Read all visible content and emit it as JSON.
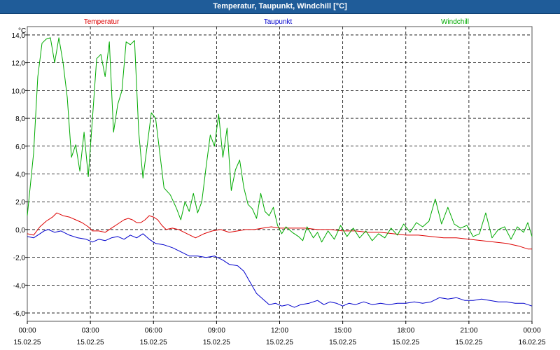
{
  "window": {
    "title": "Temperatur, Taupunkt, Windchill [°C]"
  },
  "chart_data": {
    "type": "line",
    "title": "Temperatur, Taupunkt, Windchill [°C]",
    "ylabel": "°C",
    "xlabel": "",
    "ylim": [
      -6.6,
      14.6
    ],
    "xlim": [
      0,
      24
    ],
    "grid": true,
    "legend_placement": "top",
    "y_ticks": [
      14,
      12,
      10,
      8,
      6,
      4,
      2,
      0,
      -2,
      -4,
      -6
    ],
    "y_tick_labels": [
      "14,0",
      "12,0",
      "10,0",
      "8,0",
      "6,0",
      "4,0",
      "2,0",
      "0,0",
      "-2,0",
      "-4,0",
      "-6,0"
    ],
    "x_ticks": [
      {
        "hour": 0,
        "time": "00:00",
        "date": "15.02.25"
      },
      {
        "hour": 3,
        "time": "03:00",
        "date": "15.02.25"
      },
      {
        "hour": 6,
        "time": "06:00",
        "date": "15.02.25"
      },
      {
        "hour": 9,
        "time": "09:00",
        "date": "15.02.25"
      },
      {
        "hour": 12,
        "time": "12:00",
        "date": "15.02.25"
      },
      {
        "hour": 15,
        "time": "15:00",
        "date": "15.02.25"
      },
      {
        "hour": 18,
        "time": "18:00",
        "date": "15.02.25"
      },
      {
        "hour": 21,
        "time": "21:00",
        "date": "15.02.25"
      },
      {
        "hour": 24,
        "time": "00:00",
        "date": "16.02.25"
      }
    ],
    "series": [
      {
        "name": "Temperatur",
        "color": "#dd0000",
        "points": [
          [
            0,
            -0.3
          ],
          [
            0.3,
            -0.4
          ],
          [
            0.6,
            0.2
          ],
          [
            0.9,
            0.6
          ],
          [
            1.2,
            0.9
          ],
          [
            1.4,
            1.2
          ],
          [
            1.7,
            1.0
          ],
          [
            2.0,
            0.9
          ],
          [
            2.3,
            0.7
          ],
          [
            2.6,
            0.5
          ],
          [
            2.9,
            0.2
          ],
          [
            3.1,
            -0.1
          ],
          [
            3.4,
            -0.1
          ],
          [
            3.7,
            -0.2
          ],
          [
            4.0,
            0.1
          ],
          [
            4.3,
            0.4
          ],
          [
            4.6,
            0.7
          ],
          [
            4.8,
            0.8
          ],
          [
            5.0,
            0.7
          ],
          [
            5.2,
            0.5
          ],
          [
            5.4,
            0.5
          ],
          [
            5.6,
            0.7
          ],
          [
            5.8,
            1.0
          ],
          [
            6.0,
            0.9
          ],
          [
            6.2,
            0.7
          ],
          [
            6.4,
            0.3
          ],
          [
            6.6,
            0.0
          ],
          [
            6.9,
            0.1
          ],
          [
            7.2,
            0.0
          ],
          [
            7.6,
            -0.3
          ],
          [
            8.0,
            -0.6
          ],
          [
            8.4,
            -0.3
          ],
          [
            8.8,
            -0.1
          ],
          [
            9.2,
            0.0
          ],
          [
            9.6,
            -0.2
          ],
          [
            10.0,
            -0.1
          ],
          [
            10.4,
            0.0
          ],
          [
            10.8,
            0.0
          ],
          [
            11.2,
            0.1
          ],
          [
            11.6,
            0.2
          ],
          [
            12.0,
            0.1
          ],
          [
            12.6,
            0.1
          ],
          [
            13.2,
            0.1
          ],
          [
            13.8,
            0.0
          ],
          [
            14.4,
            0.0
          ],
          [
            15.0,
            -0.1
          ],
          [
            15.6,
            -0.1
          ],
          [
            16.2,
            -0.2
          ],
          [
            16.8,
            -0.2
          ],
          [
            17.4,
            -0.3
          ],
          [
            18.0,
            -0.4
          ],
          [
            18.6,
            -0.4
          ],
          [
            19.2,
            -0.5
          ],
          [
            19.8,
            -0.6
          ],
          [
            20.4,
            -0.6
          ],
          [
            21.0,
            -0.7
          ],
          [
            21.6,
            -0.8
          ],
          [
            22.2,
            -0.9
          ],
          [
            22.8,
            -1.0
          ],
          [
            23.4,
            -1.2
          ],
          [
            23.8,
            -1.4
          ],
          [
            24.0,
            -1.4
          ]
        ]
      },
      {
        "name": "Taupunkt",
        "color": "#0000cc",
        "points": [
          [
            0,
            -0.5
          ],
          [
            0.3,
            -0.6
          ],
          [
            0.6,
            -0.3
          ],
          [
            0.8,
            -0.1
          ],
          [
            1.0,
            0.0
          ],
          [
            1.3,
            -0.2
          ],
          [
            1.6,
            -0.1
          ],
          [
            2.0,
            -0.4
          ],
          [
            2.4,
            -0.6
          ],
          [
            2.8,
            -0.7
          ],
          [
            3.1,
            -0.9
          ],
          [
            3.4,
            -0.7
          ],
          [
            3.7,
            -0.8
          ],
          [
            4.0,
            -0.6
          ],
          [
            4.3,
            -0.5
          ],
          [
            4.6,
            -0.7
          ],
          [
            4.9,
            -0.4
          ],
          [
            5.2,
            -0.6
          ],
          [
            5.5,
            -0.3
          ],
          [
            5.8,
            -0.7
          ],
          [
            6.1,
            -1.0
          ],
          [
            6.5,
            -1.1
          ],
          [
            6.9,
            -1.3
          ],
          [
            7.3,
            -1.6
          ],
          [
            7.7,
            -1.9
          ],
          [
            8.1,
            -1.9
          ],
          [
            8.5,
            -2.0
          ],
          [
            8.9,
            -1.9
          ],
          [
            9.3,
            -2.2
          ],
          [
            9.6,
            -2.5
          ],
          [
            10.0,
            -2.6
          ],
          [
            10.3,
            -3.0
          ],
          [
            10.6,
            -3.8
          ],
          [
            10.9,
            -4.6
          ],
          [
            11.2,
            -5.0
          ],
          [
            11.5,
            -5.4
          ],
          [
            11.8,
            -5.3
          ],
          [
            12.1,
            -5.5
          ],
          [
            12.4,
            -5.4
          ],
          [
            12.7,
            -5.6
          ],
          [
            13.0,
            -5.4
          ],
          [
            13.4,
            -5.3
          ],
          [
            13.8,
            -5.1
          ],
          [
            14.1,
            -5.4
          ],
          [
            14.4,
            -5.2
          ],
          [
            14.7,
            -5.3
          ],
          [
            15.0,
            -5.5
          ],
          [
            15.3,
            -5.3
          ],
          [
            15.6,
            -5.4
          ],
          [
            16.0,
            -5.2
          ],
          [
            16.4,
            -5.4
          ],
          [
            16.8,
            -5.3
          ],
          [
            17.2,
            -5.4
          ],
          [
            17.6,
            -5.3
          ],
          [
            18.0,
            -5.3
          ],
          [
            18.4,
            -5.2
          ],
          [
            18.8,
            -5.3
          ],
          [
            19.2,
            -5.2
          ],
          [
            19.6,
            -4.9
          ],
          [
            20.0,
            -5.0
          ],
          [
            20.4,
            -4.9
          ],
          [
            20.8,
            -5.1
          ],
          [
            21.2,
            -5.1
          ],
          [
            21.6,
            -5.0
          ],
          [
            22.0,
            -5.1
          ],
          [
            22.4,
            -5.2
          ],
          [
            22.8,
            -5.2
          ],
          [
            23.2,
            -5.3
          ],
          [
            23.6,
            -5.3
          ],
          [
            24.0,
            -5.5
          ]
        ]
      },
      {
        "name": "Windchill",
        "color": "#00aa00",
        "points": [
          [
            0,
            1.0
          ],
          [
            0.3,
            5.5
          ],
          [
            0.5,
            11.0
          ],
          [
            0.7,
            13.4
          ],
          [
            0.9,
            13.7
          ],
          [
            1.1,
            13.8
          ],
          [
            1.3,
            12.0
          ],
          [
            1.5,
            13.8
          ],
          [
            1.7,
            12.0
          ],
          [
            1.9,
            9.5
          ],
          [
            2.1,
            5.2
          ],
          [
            2.3,
            6.1
          ],
          [
            2.5,
            4.2
          ],
          [
            2.7,
            7.0
          ],
          [
            2.9,
            3.8
          ],
          [
            3.1,
            8.0
          ],
          [
            3.3,
            12.3
          ],
          [
            3.5,
            12.6
          ],
          [
            3.7,
            11.0
          ],
          [
            3.9,
            13.5
          ],
          [
            4.1,
            7.0
          ],
          [
            4.3,
            9.0
          ],
          [
            4.5,
            10.0
          ],
          [
            4.7,
            13.5
          ],
          [
            4.9,
            13.3
          ],
          [
            5.1,
            13.6
          ],
          [
            5.3,
            7.0
          ],
          [
            5.5,
            3.7
          ],
          [
            5.7,
            6.0
          ],
          [
            5.9,
            8.4
          ],
          [
            6.1,
            8.0
          ],
          [
            6.3,
            5.5
          ],
          [
            6.5,
            3.0
          ],
          [
            6.8,
            2.5
          ],
          [
            7.1,
            1.5
          ],
          [
            7.3,
            0.7
          ],
          [
            7.5,
            2.0
          ],
          [
            7.7,
            1.3
          ],
          [
            7.9,
            2.6
          ],
          [
            8.1,
            1.2
          ],
          [
            8.3,
            2.0
          ],
          [
            8.5,
            4.5
          ],
          [
            8.7,
            6.8
          ],
          [
            8.9,
            6.0
          ],
          [
            9.1,
            8.3
          ],
          [
            9.3,
            5.2
          ],
          [
            9.5,
            7.3
          ],
          [
            9.7,
            2.8
          ],
          [
            9.9,
            4.3
          ],
          [
            10.1,
            5.0
          ],
          [
            10.3,
            3.0
          ],
          [
            10.5,
            1.8
          ],
          [
            10.7,
            1.5
          ],
          [
            10.9,
            0.8
          ],
          [
            11.1,
            2.6
          ],
          [
            11.3,
            1.3
          ],
          [
            11.5,
            1.0
          ],
          [
            11.7,
            1.6
          ],
          [
            11.9,
            0.3
          ],
          [
            12.1,
            -0.3
          ],
          [
            12.3,
            0.2
          ],
          [
            12.6,
            -0.2
          ],
          [
            12.9,
            -0.5
          ],
          [
            13.1,
            -0.8
          ],
          [
            13.3,
            0.2
          ],
          [
            13.6,
            -0.6
          ],
          [
            13.8,
            -0.2
          ],
          [
            14.0,
            -0.9
          ],
          [
            14.3,
            -0.1
          ],
          [
            14.6,
            -0.7
          ],
          [
            14.9,
            0.3
          ],
          [
            15.2,
            -0.5
          ],
          [
            15.5,
            0.1
          ],
          [
            15.8,
            -0.6
          ],
          [
            16.1,
            -0.1
          ],
          [
            16.4,
            -0.8
          ],
          [
            16.7,
            -0.3
          ],
          [
            17.0,
            -0.6
          ],
          [
            17.3,
            0.1
          ],
          [
            17.6,
            -0.4
          ],
          [
            17.9,
            0.4
          ],
          [
            18.2,
            -0.2
          ],
          [
            18.5,
            0.5
          ],
          [
            18.8,
            0.2
          ],
          [
            19.1,
            0.6
          ],
          [
            19.4,
            2.2
          ],
          [
            19.7,
            0.4
          ],
          [
            20.0,
            1.6
          ],
          [
            20.3,
            0.4
          ],
          [
            20.6,
            0.1
          ],
          [
            20.9,
            0.3
          ],
          [
            21.2,
            -0.5
          ],
          [
            21.5,
            -0.3
          ],
          [
            21.8,
            1.2
          ],
          [
            22.1,
            -0.6
          ],
          [
            22.4,
            0.0
          ],
          [
            22.7,
            0.2
          ],
          [
            23.0,
            -0.7
          ],
          [
            23.3,
            0.2
          ],
          [
            23.6,
            -0.2
          ],
          [
            23.8,
            0.5
          ],
          [
            24.0,
            -0.5
          ]
        ]
      }
    ]
  }
}
